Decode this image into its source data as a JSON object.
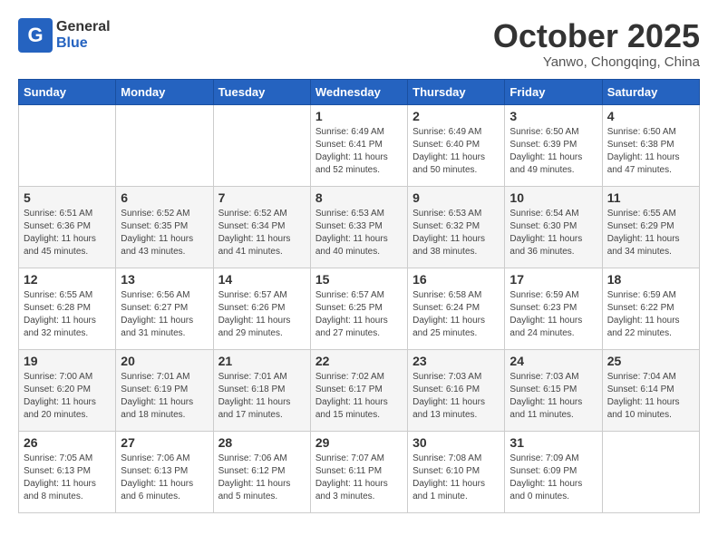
{
  "header": {
    "logo_general": "General",
    "logo_blue": "Blue",
    "title": "October 2025",
    "location": "Yanwo, Chongqing, China"
  },
  "weekdays": [
    "Sunday",
    "Monday",
    "Tuesday",
    "Wednesday",
    "Thursday",
    "Friday",
    "Saturday"
  ],
  "weeks": [
    [
      {
        "day": "",
        "info": ""
      },
      {
        "day": "",
        "info": ""
      },
      {
        "day": "",
        "info": ""
      },
      {
        "day": "1",
        "info": "Sunrise: 6:49 AM\nSunset: 6:41 PM\nDaylight: 11 hours\nand 52 minutes."
      },
      {
        "day": "2",
        "info": "Sunrise: 6:49 AM\nSunset: 6:40 PM\nDaylight: 11 hours\nand 50 minutes."
      },
      {
        "day": "3",
        "info": "Sunrise: 6:50 AM\nSunset: 6:39 PM\nDaylight: 11 hours\nand 49 minutes."
      },
      {
        "day": "4",
        "info": "Sunrise: 6:50 AM\nSunset: 6:38 PM\nDaylight: 11 hours\nand 47 minutes."
      }
    ],
    [
      {
        "day": "5",
        "info": "Sunrise: 6:51 AM\nSunset: 6:36 PM\nDaylight: 11 hours\nand 45 minutes."
      },
      {
        "day": "6",
        "info": "Sunrise: 6:52 AM\nSunset: 6:35 PM\nDaylight: 11 hours\nand 43 minutes."
      },
      {
        "day": "7",
        "info": "Sunrise: 6:52 AM\nSunset: 6:34 PM\nDaylight: 11 hours\nand 41 minutes."
      },
      {
        "day": "8",
        "info": "Sunrise: 6:53 AM\nSunset: 6:33 PM\nDaylight: 11 hours\nand 40 minutes."
      },
      {
        "day": "9",
        "info": "Sunrise: 6:53 AM\nSunset: 6:32 PM\nDaylight: 11 hours\nand 38 minutes."
      },
      {
        "day": "10",
        "info": "Sunrise: 6:54 AM\nSunset: 6:30 PM\nDaylight: 11 hours\nand 36 minutes."
      },
      {
        "day": "11",
        "info": "Sunrise: 6:55 AM\nSunset: 6:29 PM\nDaylight: 11 hours\nand 34 minutes."
      }
    ],
    [
      {
        "day": "12",
        "info": "Sunrise: 6:55 AM\nSunset: 6:28 PM\nDaylight: 11 hours\nand 32 minutes."
      },
      {
        "day": "13",
        "info": "Sunrise: 6:56 AM\nSunset: 6:27 PM\nDaylight: 11 hours\nand 31 minutes."
      },
      {
        "day": "14",
        "info": "Sunrise: 6:57 AM\nSunset: 6:26 PM\nDaylight: 11 hours\nand 29 minutes."
      },
      {
        "day": "15",
        "info": "Sunrise: 6:57 AM\nSunset: 6:25 PM\nDaylight: 11 hours\nand 27 minutes."
      },
      {
        "day": "16",
        "info": "Sunrise: 6:58 AM\nSunset: 6:24 PM\nDaylight: 11 hours\nand 25 minutes."
      },
      {
        "day": "17",
        "info": "Sunrise: 6:59 AM\nSunset: 6:23 PM\nDaylight: 11 hours\nand 24 minutes."
      },
      {
        "day": "18",
        "info": "Sunrise: 6:59 AM\nSunset: 6:22 PM\nDaylight: 11 hours\nand 22 minutes."
      }
    ],
    [
      {
        "day": "19",
        "info": "Sunrise: 7:00 AM\nSunset: 6:20 PM\nDaylight: 11 hours\nand 20 minutes."
      },
      {
        "day": "20",
        "info": "Sunrise: 7:01 AM\nSunset: 6:19 PM\nDaylight: 11 hours\nand 18 minutes."
      },
      {
        "day": "21",
        "info": "Sunrise: 7:01 AM\nSunset: 6:18 PM\nDaylight: 11 hours\nand 17 minutes."
      },
      {
        "day": "22",
        "info": "Sunrise: 7:02 AM\nSunset: 6:17 PM\nDaylight: 11 hours\nand 15 minutes."
      },
      {
        "day": "23",
        "info": "Sunrise: 7:03 AM\nSunset: 6:16 PM\nDaylight: 11 hours\nand 13 minutes."
      },
      {
        "day": "24",
        "info": "Sunrise: 7:03 AM\nSunset: 6:15 PM\nDaylight: 11 hours\nand 11 minutes."
      },
      {
        "day": "25",
        "info": "Sunrise: 7:04 AM\nSunset: 6:14 PM\nDaylight: 11 hours\nand 10 minutes."
      }
    ],
    [
      {
        "day": "26",
        "info": "Sunrise: 7:05 AM\nSunset: 6:13 PM\nDaylight: 11 hours\nand 8 minutes."
      },
      {
        "day": "27",
        "info": "Sunrise: 7:06 AM\nSunset: 6:13 PM\nDaylight: 11 hours\nand 6 minutes."
      },
      {
        "day": "28",
        "info": "Sunrise: 7:06 AM\nSunset: 6:12 PM\nDaylight: 11 hours\nand 5 minutes."
      },
      {
        "day": "29",
        "info": "Sunrise: 7:07 AM\nSunset: 6:11 PM\nDaylight: 11 hours\nand 3 minutes."
      },
      {
        "day": "30",
        "info": "Sunrise: 7:08 AM\nSunset: 6:10 PM\nDaylight: 11 hours\nand 1 minute."
      },
      {
        "day": "31",
        "info": "Sunrise: 7:09 AM\nSunset: 6:09 PM\nDaylight: 11 hours\nand 0 minutes."
      },
      {
        "day": "",
        "info": ""
      }
    ]
  ]
}
